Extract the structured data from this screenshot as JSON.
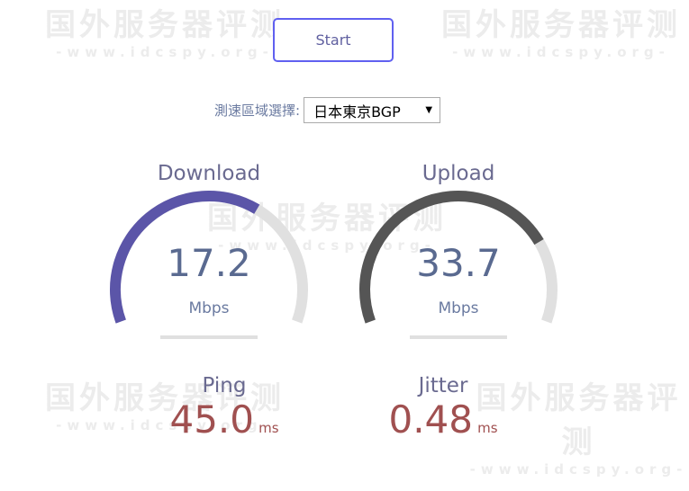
{
  "watermark": {
    "title": "国外服务器评测",
    "url": "-www.idcspy.org-"
  },
  "start_button": {
    "label": "Start"
  },
  "region": {
    "label": "測速區域選擇:",
    "selected": "日本東京BGP"
  },
  "download": {
    "title": "Download",
    "value": "17.2",
    "unit": "Mbps",
    "gauge_fraction": 0.64,
    "color": "#5b55a8"
  },
  "upload": {
    "title": "Upload",
    "value": "33.7",
    "unit": "Mbps",
    "gauge_fraction": 0.77,
    "color": "#555555"
  },
  "ping": {
    "title": "Ping",
    "value": "45.0",
    "unit": "ms"
  },
  "jitter": {
    "title": "Jitter",
    "value": "0.48",
    "unit": "ms"
  },
  "colors": {
    "track": "#e0e0e0",
    "accent": "#6060f0",
    "metric": "#a05050"
  }
}
